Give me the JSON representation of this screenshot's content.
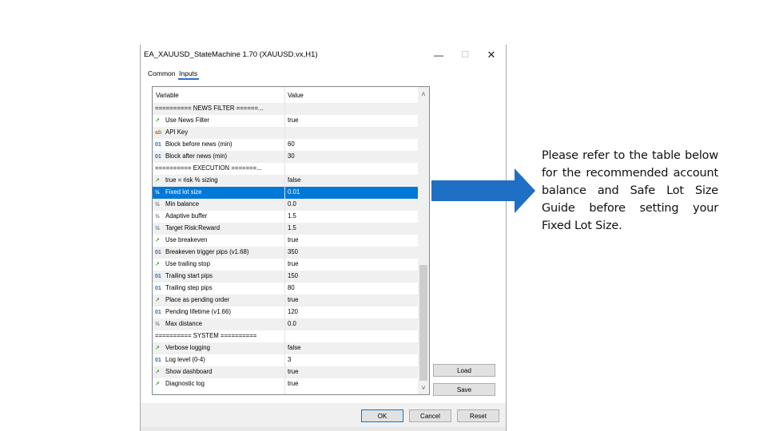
{
  "window": {
    "title": "EA_XAUUSD_StateMachine 1.70 (XAUUSD.vx,H1)",
    "min_glyph": "—",
    "max_glyph": "☐",
    "close_glyph": "✕"
  },
  "tabs": [
    "Common",
    "Inputs"
  ],
  "active_tab": "Inputs",
  "grid": {
    "headers": {
      "variable": "Variable",
      "value": "Value"
    },
    "rows": [
      {
        "icon": "",
        "variable": "========== NEWS FILTER ======...",
        "value": ""
      },
      {
        "icon": "bool",
        "variable": "Use News Filter",
        "value": "true"
      },
      {
        "icon": "str",
        "variable": "API Key",
        "value": ""
      },
      {
        "icon": "int",
        "variable": "Block before news (min)",
        "value": "60"
      },
      {
        "icon": "int",
        "variable": "Block after news (min)",
        "value": "30"
      },
      {
        "icon": "",
        "variable": "========== EXECUTION =======...",
        "value": ""
      },
      {
        "icon": "bool",
        "variable": "true = risk % sizing",
        "value": "false"
      },
      {
        "icon": "dbl",
        "variable": "Fixed lot size",
        "value": "0.01",
        "selected": true
      },
      {
        "icon": "dbl",
        "variable": "Min balance",
        "value": "0.0"
      },
      {
        "icon": "dbl",
        "variable": "Adaptive buffer",
        "value": "1.5"
      },
      {
        "icon": "dbl",
        "variable": "Target Risk:Reward",
        "value": "1.5"
      },
      {
        "icon": "bool",
        "variable": "Use breakeven",
        "value": "true"
      },
      {
        "icon": "int",
        "variable": "Breakeven trigger pips (v1.68)",
        "value": "350"
      },
      {
        "icon": "bool",
        "variable": "Use trailing stop",
        "value": "true"
      },
      {
        "icon": "int",
        "variable": "Trailing start pips",
        "value": "150"
      },
      {
        "icon": "int",
        "variable": "Trailing step pips",
        "value": "80"
      },
      {
        "icon": "bool",
        "variable": "Place as pending order",
        "value": "true"
      },
      {
        "icon": "int",
        "variable": "Pending lifetime (v1.66)",
        "value": "120"
      },
      {
        "icon": "dbl",
        "variable": "Max distance",
        "value": "0.0"
      },
      {
        "icon": "",
        "variable": "========== SYSTEM ==========",
        "value": ""
      },
      {
        "icon": "bool",
        "variable": "Verbose logging",
        "value": "false"
      },
      {
        "icon": "int",
        "variable": "Log level (0-4)",
        "value": "3"
      },
      {
        "icon": "bool",
        "variable": "Show dashboard",
        "value": "true"
      },
      {
        "icon": "bool",
        "variable": "Diagnostic log",
        "value": "true"
      }
    ]
  },
  "icons": {
    "bool": "↗",
    "int": "01",
    "dbl": "½",
    "str": "ab"
  },
  "buttons": {
    "load": "Load",
    "save": "Save",
    "ok": "OK",
    "cancel": "Cancel",
    "reset": "Reset"
  },
  "note": "Please refer to the table below for the recommended account balance and Safe Lot Size Guide before setting your Fixed Lot Size.",
  "colors": {
    "selection": "#0078d7",
    "arrow": "#1f6fc4"
  }
}
